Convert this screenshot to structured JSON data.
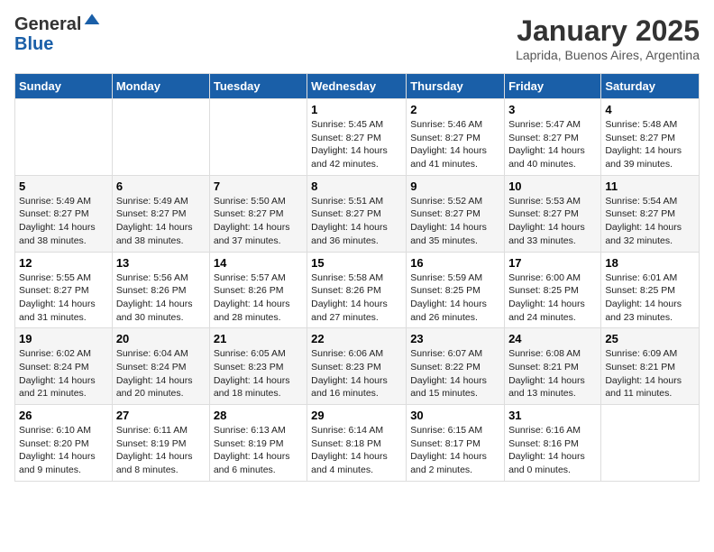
{
  "logo": {
    "general": "General",
    "blue": "Blue"
  },
  "title": "January 2025",
  "location": "Laprida, Buenos Aires, Argentina",
  "weekdays": [
    "Sunday",
    "Monday",
    "Tuesday",
    "Wednesday",
    "Thursday",
    "Friday",
    "Saturday"
  ],
  "weeks": [
    [
      {
        "day": "",
        "sunrise": "",
        "sunset": "",
        "daylight": ""
      },
      {
        "day": "",
        "sunrise": "",
        "sunset": "",
        "daylight": ""
      },
      {
        "day": "",
        "sunrise": "",
        "sunset": "",
        "daylight": ""
      },
      {
        "day": "1",
        "sunrise": "Sunrise: 5:45 AM",
        "sunset": "Sunset: 8:27 PM",
        "daylight": "Daylight: 14 hours and 42 minutes."
      },
      {
        "day": "2",
        "sunrise": "Sunrise: 5:46 AM",
        "sunset": "Sunset: 8:27 PM",
        "daylight": "Daylight: 14 hours and 41 minutes."
      },
      {
        "day": "3",
        "sunrise": "Sunrise: 5:47 AM",
        "sunset": "Sunset: 8:27 PM",
        "daylight": "Daylight: 14 hours and 40 minutes."
      },
      {
        "day": "4",
        "sunrise": "Sunrise: 5:48 AM",
        "sunset": "Sunset: 8:27 PM",
        "daylight": "Daylight: 14 hours and 39 minutes."
      }
    ],
    [
      {
        "day": "5",
        "sunrise": "Sunrise: 5:49 AM",
        "sunset": "Sunset: 8:27 PM",
        "daylight": "Daylight: 14 hours and 38 minutes."
      },
      {
        "day": "6",
        "sunrise": "Sunrise: 5:49 AM",
        "sunset": "Sunset: 8:27 PM",
        "daylight": "Daylight: 14 hours and 38 minutes."
      },
      {
        "day": "7",
        "sunrise": "Sunrise: 5:50 AM",
        "sunset": "Sunset: 8:27 PM",
        "daylight": "Daylight: 14 hours and 37 minutes."
      },
      {
        "day": "8",
        "sunrise": "Sunrise: 5:51 AM",
        "sunset": "Sunset: 8:27 PM",
        "daylight": "Daylight: 14 hours and 36 minutes."
      },
      {
        "day": "9",
        "sunrise": "Sunrise: 5:52 AM",
        "sunset": "Sunset: 8:27 PM",
        "daylight": "Daylight: 14 hours and 35 minutes."
      },
      {
        "day": "10",
        "sunrise": "Sunrise: 5:53 AM",
        "sunset": "Sunset: 8:27 PM",
        "daylight": "Daylight: 14 hours and 33 minutes."
      },
      {
        "day": "11",
        "sunrise": "Sunrise: 5:54 AM",
        "sunset": "Sunset: 8:27 PM",
        "daylight": "Daylight: 14 hours and 32 minutes."
      }
    ],
    [
      {
        "day": "12",
        "sunrise": "Sunrise: 5:55 AM",
        "sunset": "Sunset: 8:27 PM",
        "daylight": "Daylight: 14 hours and 31 minutes."
      },
      {
        "day": "13",
        "sunrise": "Sunrise: 5:56 AM",
        "sunset": "Sunset: 8:26 PM",
        "daylight": "Daylight: 14 hours and 30 minutes."
      },
      {
        "day": "14",
        "sunrise": "Sunrise: 5:57 AM",
        "sunset": "Sunset: 8:26 PM",
        "daylight": "Daylight: 14 hours and 28 minutes."
      },
      {
        "day": "15",
        "sunrise": "Sunrise: 5:58 AM",
        "sunset": "Sunset: 8:26 PM",
        "daylight": "Daylight: 14 hours and 27 minutes."
      },
      {
        "day": "16",
        "sunrise": "Sunrise: 5:59 AM",
        "sunset": "Sunset: 8:25 PM",
        "daylight": "Daylight: 14 hours and 26 minutes."
      },
      {
        "day": "17",
        "sunrise": "Sunrise: 6:00 AM",
        "sunset": "Sunset: 8:25 PM",
        "daylight": "Daylight: 14 hours and 24 minutes."
      },
      {
        "day": "18",
        "sunrise": "Sunrise: 6:01 AM",
        "sunset": "Sunset: 8:25 PM",
        "daylight": "Daylight: 14 hours and 23 minutes."
      }
    ],
    [
      {
        "day": "19",
        "sunrise": "Sunrise: 6:02 AM",
        "sunset": "Sunset: 8:24 PM",
        "daylight": "Daylight: 14 hours and 21 minutes."
      },
      {
        "day": "20",
        "sunrise": "Sunrise: 6:04 AM",
        "sunset": "Sunset: 8:24 PM",
        "daylight": "Daylight: 14 hours and 20 minutes."
      },
      {
        "day": "21",
        "sunrise": "Sunrise: 6:05 AM",
        "sunset": "Sunset: 8:23 PM",
        "daylight": "Daylight: 14 hours and 18 minutes."
      },
      {
        "day": "22",
        "sunrise": "Sunrise: 6:06 AM",
        "sunset": "Sunset: 8:23 PM",
        "daylight": "Daylight: 14 hours and 16 minutes."
      },
      {
        "day": "23",
        "sunrise": "Sunrise: 6:07 AM",
        "sunset": "Sunset: 8:22 PM",
        "daylight": "Daylight: 14 hours and 15 minutes."
      },
      {
        "day": "24",
        "sunrise": "Sunrise: 6:08 AM",
        "sunset": "Sunset: 8:21 PM",
        "daylight": "Daylight: 14 hours and 13 minutes."
      },
      {
        "day": "25",
        "sunrise": "Sunrise: 6:09 AM",
        "sunset": "Sunset: 8:21 PM",
        "daylight": "Daylight: 14 hours and 11 minutes."
      }
    ],
    [
      {
        "day": "26",
        "sunrise": "Sunrise: 6:10 AM",
        "sunset": "Sunset: 8:20 PM",
        "daylight": "Daylight: 14 hours and 9 minutes."
      },
      {
        "day": "27",
        "sunrise": "Sunrise: 6:11 AM",
        "sunset": "Sunset: 8:19 PM",
        "daylight": "Daylight: 14 hours and 8 minutes."
      },
      {
        "day": "28",
        "sunrise": "Sunrise: 6:13 AM",
        "sunset": "Sunset: 8:19 PM",
        "daylight": "Daylight: 14 hours and 6 minutes."
      },
      {
        "day": "29",
        "sunrise": "Sunrise: 6:14 AM",
        "sunset": "Sunset: 8:18 PM",
        "daylight": "Daylight: 14 hours and 4 minutes."
      },
      {
        "day": "30",
        "sunrise": "Sunrise: 6:15 AM",
        "sunset": "Sunset: 8:17 PM",
        "daylight": "Daylight: 14 hours and 2 minutes."
      },
      {
        "day": "31",
        "sunrise": "Sunrise: 6:16 AM",
        "sunset": "Sunset: 8:16 PM",
        "daylight": "Daylight: 14 hours and 0 minutes."
      },
      {
        "day": "",
        "sunrise": "",
        "sunset": "",
        "daylight": ""
      }
    ]
  ]
}
